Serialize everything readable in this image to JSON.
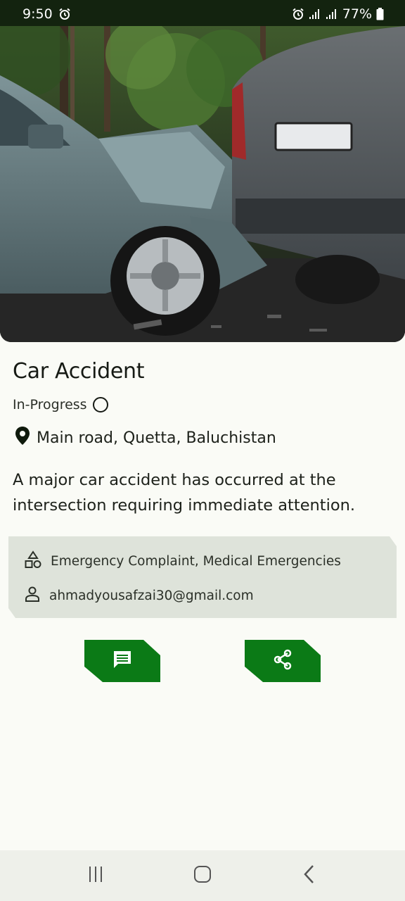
{
  "status_bar": {
    "time": "9:50",
    "battery": "77%",
    "icons": [
      "alarm-icon",
      "signal-icon",
      "battery-icon"
    ]
  },
  "hero": {
    "image": "car-accident-photo"
  },
  "incident": {
    "title": "Car Accident",
    "status": "In-Progress",
    "location": "Main road, Quetta, Baluchistan",
    "description": "A major car accident has occurred at the intersection requiring immediate attention."
  },
  "info": {
    "category": "Emergency Complaint, Medical Emergencies",
    "email": "ahmadyousafzai30@gmail.com"
  },
  "actions": {
    "comment_icon": "comment-icon",
    "share_icon": "share-icon"
  },
  "colors": {
    "accent": "#0b7a16",
    "status_bar": "#13230f",
    "card": "#dee3da",
    "background": "#fafbf6"
  },
  "nav": {
    "items": [
      "recent-apps-icon",
      "home-icon",
      "back-icon"
    ]
  }
}
